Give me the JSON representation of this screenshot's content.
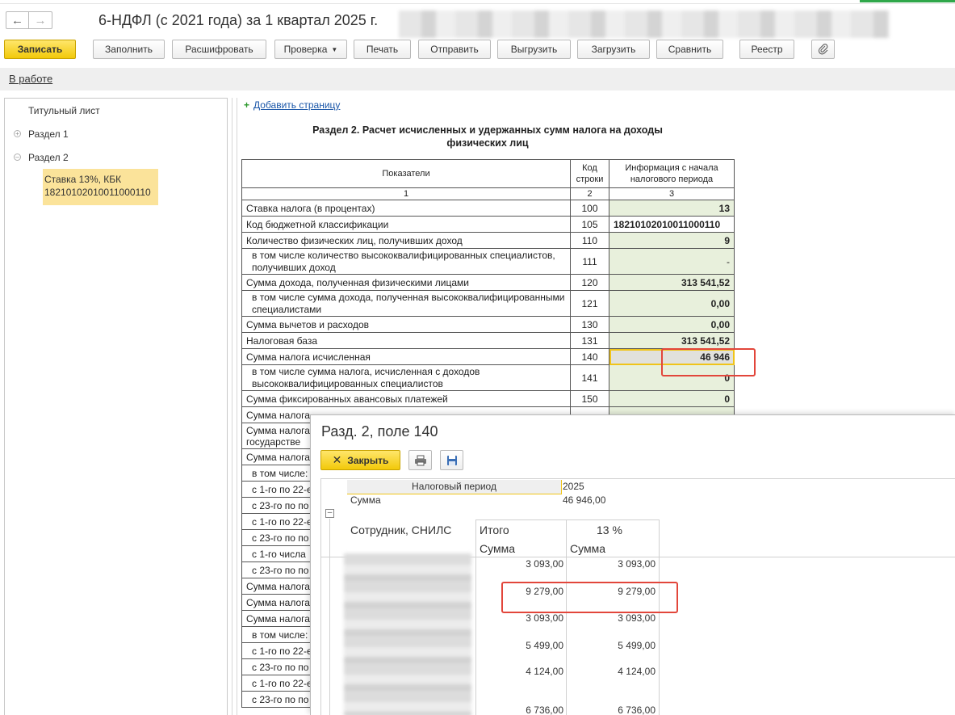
{
  "window": {
    "title": "6-НДФЛ (с 2021 года) за 1 квартал 2025 г."
  },
  "toolbar": {
    "save": "Записать",
    "fill": "Заполнить",
    "decode": "Расшифровать",
    "check": "Проверка",
    "print": "Печать",
    "send": "Отправить",
    "export": "Выгрузить",
    "import": "Загрузить",
    "compare": "Сравнить",
    "registry": "Реестр"
  },
  "status": {
    "state": "В работе"
  },
  "tree": {
    "items": [
      {
        "label": "Титульный лист"
      },
      {
        "label": "Раздел 1"
      },
      {
        "label": "Раздел 2"
      }
    ],
    "selected_line1": "Ставка 13%, КБК",
    "selected_line2": "18210102010011000110"
  },
  "main": {
    "add_page": "Добавить страницу",
    "section_title_line1": "Раздел 2. Расчет исчисленных и удержанных сумм налога на доходы",
    "section_title_line2": "физических лиц",
    "header": {
      "indicators": "Показатели",
      "code": "Код строки",
      "info": "Информация с начала налогового периода",
      "n1": "1",
      "n2": "2",
      "n3": "3"
    },
    "rows": [
      {
        "label": "Ставка налога (в процентах)",
        "code": "100",
        "value": "13"
      },
      {
        "label": "Код бюджетной классификации",
        "code": "105",
        "value": "18210102010011000110"
      },
      {
        "label": "Количество физических лиц, получивших доход",
        "code": "110",
        "value": "9"
      },
      {
        "label": "в том числе количество высококвалифицированных специалистов, получивших доход",
        "code": "111",
        "value": "-"
      },
      {
        "label": "Сумма дохода, полученная физическими лицами",
        "code": "120",
        "value": "313 541,52"
      },
      {
        "label": "в том числе сумма дохода, полученная высококвалифицированными специалистами",
        "code": "121",
        "value": "0,00"
      },
      {
        "label": "Сумма вычетов и расходов",
        "code": "130",
        "value": "0,00"
      },
      {
        "label": "Налоговая база",
        "code": "131",
        "value": "313 541,52"
      },
      {
        "label": "Сумма налога исчисленная",
        "code": "140",
        "value": "46 946"
      },
      {
        "label": "в том числе сумма налога, исчисленная с доходов высококвалифицированных специалистов",
        "code": "141",
        "value": "0"
      },
      {
        "label": "Сумма фиксированных авансовых платежей",
        "code": "150",
        "value": "0"
      }
    ],
    "partial_rows": [
      "Сумма налога",
      "Сумма налога",
      "государстве",
      "Сумма налога",
      "в том числе:",
      "с 1-го по 22-е",
      "с 23-го по по",
      "с 1-го по 22-е",
      "с 23-го по по",
      "с 1-го числа",
      "с 23-го по по",
      "Сумма налога",
      "Сумма налога",
      "Сумма налога",
      "в том числе:",
      "с 1-го по 22-е",
      "с 23-го по по",
      "с 1-го по 22-е",
      "с 23-го по по"
    ]
  },
  "popup": {
    "title": "Разд. 2, поле 140",
    "close": "Закрыть",
    "period_label": "Налоговый период",
    "period_value": "2025",
    "sum_label": "Сумма",
    "sum_value": "46 946,00",
    "col_employee": "Сотрудник, СНИЛС",
    "col_total": "Итого",
    "col_rate": "13 %",
    "col_total_sub": "Сумма",
    "col_rate_sub": "Сумма",
    "rows": [
      {
        "total": "3 093,00",
        "rate": "3 093,00"
      },
      {
        "total": "9 279,00",
        "rate": "9 279,00"
      },
      {
        "total": "3 093,00",
        "rate": "3 093,00"
      },
      {
        "total": "5 499,00",
        "rate": "5 499,00"
      },
      {
        "total": "4 124,00",
        "rate": "4 124,00"
      },
      {
        "total": "6 736,00",
        "rate": "6 736,00"
      }
    ]
  }
}
